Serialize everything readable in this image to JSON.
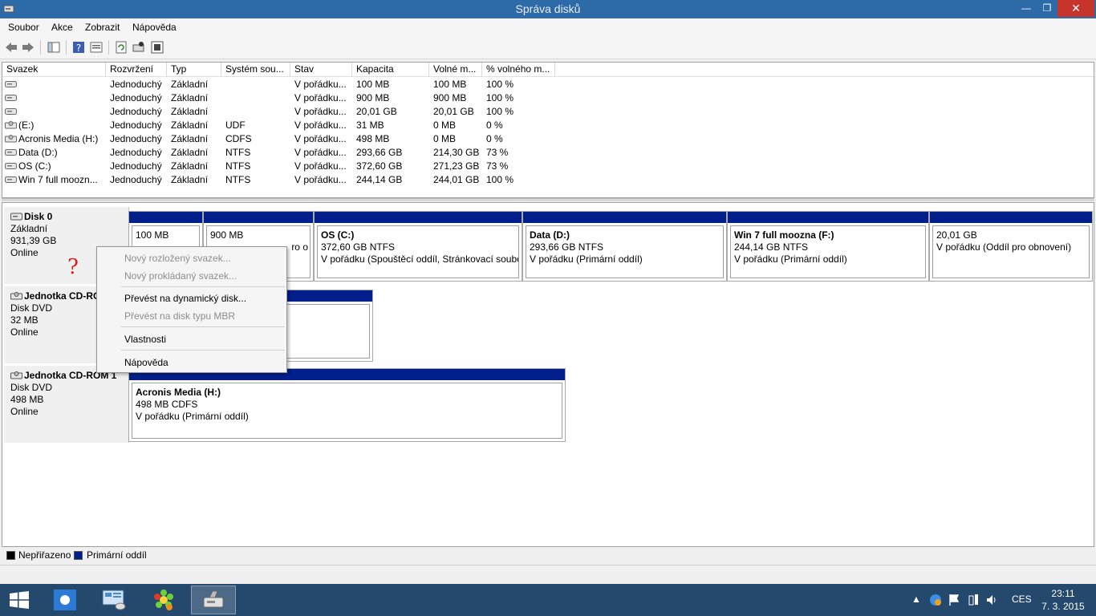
{
  "window": {
    "title": "Správa disků",
    "min_label": "—",
    "max_label": "❐",
    "close_label": "✕"
  },
  "menu": [
    "Soubor",
    "Akce",
    "Zobrazit",
    "Nápověda"
  ],
  "toolbar_icons": [
    "back-icon",
    "forward-icon",
    "console-tree-icon",
    "help-icon",
    "properties-icon",
    "refresh-icon",
    "disk-settings-icon",
    "export-icon"
  ],
  "columns": [
    "Svazek",
    "Rozvržení",
    "Typ",
    "Systém sou...",
    "Stav",
    "Kapacita",
    "Volné m...",
    "% volného m..."
  ],
  "volumes": [
    {
      "name": "",
      "layout": "Jednoduchý",
      "type": "Základní",
      "fs": "",
      "status": "V pořádku...",
      "capacity": "100 MB",
      "free": "100 MB",
      "pct": "100 %",
      "icon": "volume-icon"
    },
    {
      "name": "",
      "layout": "Jednoduchý",
      "type": "Základní",
      "fs": "",
      "status": "V pořádku...",
      "capacity": "900 MB",
      "free": "900 MB",
      "pct": "100 %",
      "icon": "volume-icon"
    },
    {
      "name": "",
      "layout": "Jednoduchý",
      "type": "Základní",
      "fs": "",
      "status": "V pořádku...",
      "capacity": "20,01 GB",
      "free": "20,01 GB",
      "pct": "100 %",
      "icon": "volume-icon"
    },
    {
      "name": "(E:)",
      "layout": "Jednoduchý",
      "type": "Základní",
      "fs": "UDF",
      "status": "V pořádku...",
      "capacity": "31 MB",
      "free": "0 MB",
      "pct": "0 %",
      "icon": "cdrom-icon"
    },
    {
      "name": "Acronis Media (H:)",
      "layout": "Jednoduchý",
      "type": "Základní",
      "fs": "CDFS",
      "status": "V pořádku...",
      "capacity": "498 MB",
      "free": "0 MB",
      "pct": "0 %",
      "icon": "cdrom-icon"
    },
    {
      "name": "Data (D:)",
      "layout": "Jednoduchý",
      "type": "Základní",
      "fs": "NTFS",
      "status": "V pořádku...",
      "capacity": "293,66 GB",
      "free": "214,30 GB",
      "pct": "73 %",
      "icon": "volume-icon"
    },
    {
      "name": "OS (C:)",
      "layout": "Jednoduchý",
      "type": "Základní",
      "fs": "NTFS",
      "status": "V pořádku...",
      "capacity": "372,60 GB",
      "free": "271,23 GB",
      "pct": "73 %",
      "icon": "volume-icon"
    },
    {
      "name": "Win 7 full  moozn...",
      "layout": "Jednoduchý",
      "type": "Základní",
      "fs": "NTFS",
      "status": "V pořádku...",
      "capacity": "244,14 GB",
      "free": "244,01 GB",
      "pct": "100 %",
      "icon": "volume-icon"
    }
  ],
  "disks": [
    {
      "name": "Disk 0",
      "kind": "Základní",
      "size": "931,39 GB",
      "state": "Online",
      "partitions": [
        {
          "name": "",
          "line1": "100 MB",
          "line2": ""
        },
        {
          "name": "",
          "line1": "900 MB",
          "line2": "ro o"
        },
        {
          "name": "OS  (C:)",
          "line1": "372,60 GB NTFS",
          "line2": "V pořádku (Spouštěcí oddíl, Stránkovací soubo"
        },
        {
          "name": "Data  (D:)",
          "line1": "293,66 GB NTFS",
          "line2": "V pořádku (Primární oddíl)"
        },
        {
          "name": "Win 7 full  moozna  (F:)",
          "line1": "244,14 GB NTFS",
          "line2": "V pořádku (Primární oddíl)"
        },
        {
          "name": "",
          "line1": "20,01 GB",
          "line2": "V pořádku (Oddíl pro obnovení)"
        }
      ]
    },
    {
      "name": "Jednotka CD-ROM 0",
      "kind": "Disk DVD",
      "size": "32 MB",
      "state": "Online",
      "partitions": []
    },
    {
      "name": "Jednotka CD-ROM 1",
      "kind": "Disk DVD",
      "size": "498 MB",
      "state": "Online",
      "partitions": [
        {
          "name": "Acronis Media  (H:)",
          "line1": "498 MB CDFS",
          "line2": "V pořádku (Primární oddíl)"
        }
      ]
    }
  ],
  "context_menu": {
    "items": [
      {
        "label": "Nový rozložený svazek...",
        "enabled": false
      },
      {
        "label": "Nový prokládaný svazek...",
        "enabled": false
      },
      {
        "label": "Převést na dynamický disk...",
        "enabled": true
      },
      {
        "label": "Převést na disk typu MBR",
        "enabled": false
      },
      {
        "label": "Vlastnosti",
        "enabled": true
      },
      {
        "label": "Nápověda",
        "enabled": true
      }
    ],
    "marker": "?"
  },
  "legend": [
    {
      "label": "Nepřiřazeno",
      "color": "#000000"
    },
    {
      "label": "Primární oddíl",
      "color": "#001f8b"
    }
  ],
  "taskbar": {
    "apps": [
      "weather-app-icon",
      "control-panel-icon",
      "icq-icon",
      "disk-management-icon"
    ],
    "tray_lang": "CES",
    "time": "23:11",
    "date": "7. 3. 2015"
  },
  "colors": {
    "titlebar": "#2c6aa8",
    "primary_partition": "#001f8b",
    "taskbar": "#25496d",
    "close_button": "#c7342c"
  }
}
